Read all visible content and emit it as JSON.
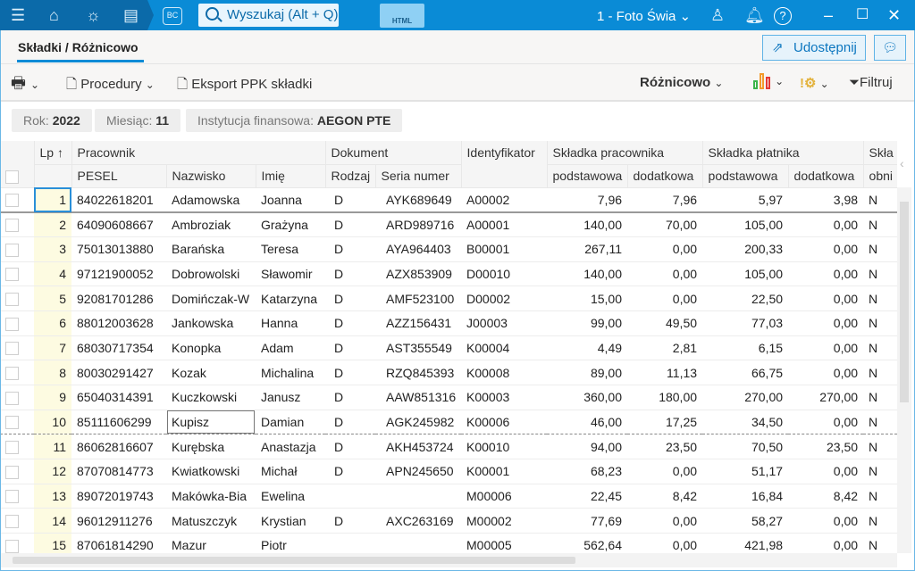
{
  "topbar": {
    "search_placeholder": "Wyszukaj (Alt + Q)",
    "bc_label": "BC",
    "html_label": "HTML",
    "company": "1 - Foto Świa",
    "icons": [
      "menu-icon",
      "home-icon",
      "lightbulb-icon",
      "newspaper-icon",
      "user-icon",
      "bell-icon",
      "help-icon",
      "minimize-icon",
      "maximize-icon",
      "close-icon"
    ]
  },
  "tab": {
    "title": "Składki / Różnicowo"
  },
  "actions": {
    "share": "Udostępnij"
  },
  "toolbar": {
    "procedury": "Procedury",
    "eksport": "Eksport PPK składki",
    "view": "Różnicowo",
    "filter": "Filtruj"
  },
  "filters": {
    "rok_label": "Rok:",
    "rok": "2022",
    "miesiac_label": "Miesiąc:",
    "miesiac": "11",
    "inst_label": "Instytucja finansowa:",
    "inst": "AEGON PTE"
  },
  "columns": {
    "lp": "Lp",
    "pracownik": "Pracownik",
    "pesel": "PESEL",
    "nazwisko": "Nazwisko",
    "imie": "Imię",
    "dokument": "Dokument",
    "rodzaj": "Rodzaj",
    "seria": "Seria numer",
    "ident": "Identyfikator",
    "skl_prac": "Składka pracownika",
    "skl_plat": "Składka płatnika",
    "podst": "podstawowa",
    "dod": "dodatkowa",
    "skl3": "Skła",
    "obni": "obni"
  },
  "rows": [
    [
      "1",
      "84022618201",
      "Adamowska",
      "Joanna",
      "D",
      "AYK689649",
      "A00002",
      "7,96",
      "7,96",
      "5,97",
      "3,98",
      "N"
    ],
    [
      "2",
      "64090608667",
      "Ambroziak",
      "Grażyna",
      "D",
      "ARD989716",
      "A00001",
      "140,00",
      "70,00",
      "105,00",
      "0,00",
      "N"
    ],
    [
      "3",
      "75013013880",
      "Barańska",
      "Teresa",
      "D",
      "AYA964403",
      "B00001",
      "267,11",
      "0,00",
      "200,33",
      "0,00",
      "N"
    ],
    [
      "4",
      "97121900052",
      "Dobrowolski",
      "Sławomir",
      "D",
      "AZX853909",
      "D00010",
      "140,00",
      "0,00",
      "105,00",
      "0,00",
      "N"
    ],
    [
      "5",
      "92081701286",
      "Domińczak-W",
      "Katarzyna",
      "D",
      "AMF523100",
      "D00002",
      "15,00",
      "0,00",
      "22,50",
      "0,00",
      "N"
    ],
    [
      "6",
      "88012003628",
      "Jankowska",
      "Hanna",
      "D",
      "AZZ156431",
      "J00003",
      "99,00",
      "49,50",
      "77,03",
      "0,00",
      "N"
    ],
    [
      "7",
      "68030717354",
      "Konopka",
      "Adam",
      "D",
      "AST355549",
      "K00004",
      "4,49",
      "2,81",
      "6,15",
      "0,00",
      "N"
    ],
    [
      "8",
      "80030291427",
      "Kozak",
      "Michalina",
      "D",
      "RZQ845393",
      "K00008",
      "89,00",
      "11,13",
      "66,75",
      "0,00",
      "N"
    ],
    [
      "9",
      "65040314391",
      "Kuczkowski",
      "Janusz",
      "D",
      "AAW851316",
      "K00003",
      "360,00",
      "180,00",
      "270,00",
      "270,00",
      "N"
    ],
    [
      "10",
      "85111606299",
      "Kupisz",
      "Damian",
      "D",
      "AGK245982",
      "K00006",
      "46,00",
      "17,25",
      "34,50",
      "0,00",
      "N"
    ],
    [
      "11",
      "86062816607",
      "Kurębska",
      "Anastazja",
      "D",
      "AKH453724",
      "K00010",
      "94,00",
      "23,50",
      "70,50",
      "23,50",
      "N"
    ],
    [
      "12",
      "87070814773",
      "Kwiatkowski",
      "Michał",
      "D",
      "APN245650",
      "K00001",
      "68,23",
      "0,00",
      "51,17",
      "0,00",
      "N"
    ],
    [
      "13",
      "89072019743",
      "Makówka-Bia",
      "Ewelina",
      "",
      "",
      "M00006",
      "22,45",
      "8,42",
      "16,84",
      "8,42",
      "N"
    ],
    [
      "14",
      "96012911276",
      "Matuszczyk",
      "Krystian",
      "D",
      "AXC263169",
      "M00002",
      "77,69",
      "0,00",
      "58,27",
      "0,00",
      "N"
    ],
    [
      "15",
      "87061814290",
      "Mazur",
      "Piotr",
      "",
      "",
      "M00005",
      "562,64",
      "0,00",
      "421,98",
      "0,00",
      "N"
    ]
  ]
}
